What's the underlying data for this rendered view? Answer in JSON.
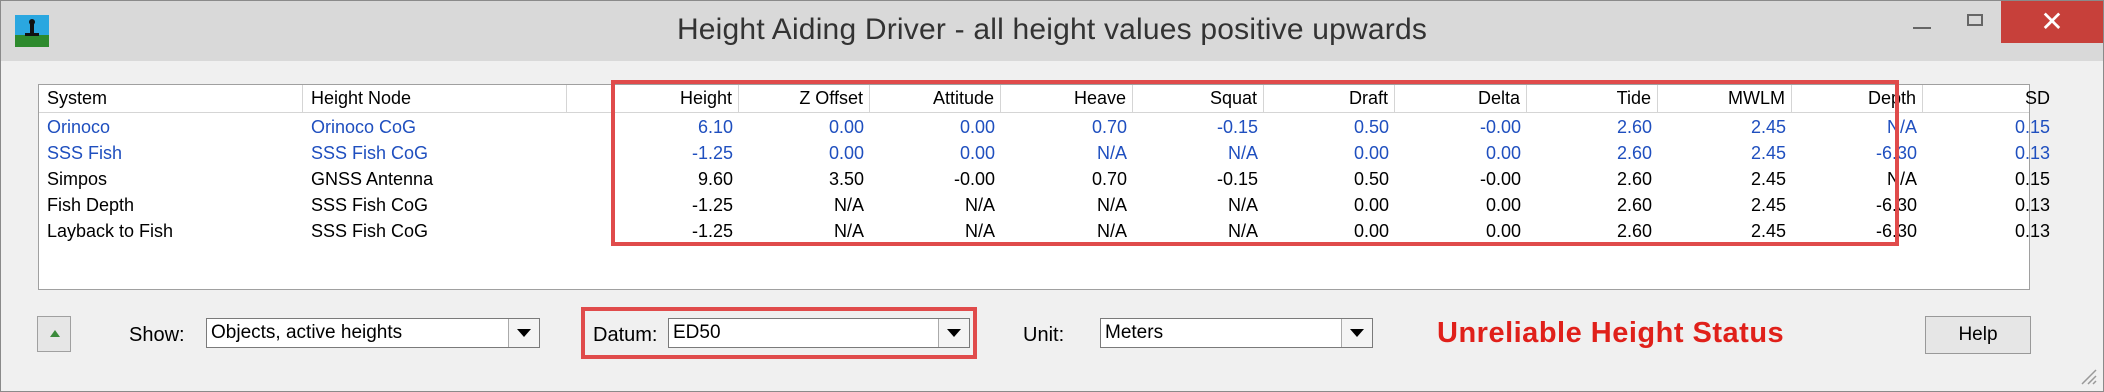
{
  "window": {
    "title": "Height Aiding Driver - all height values positive upwards"
  },
  "columns": [
    "System",
    "Height Node",
    "Height",
    "Z Offset",
    "Attitude",
    "Heave",
    "Squat",
    "Draft",
    "Delta",
    "Tide",
    "MWLM",
    "Depth",
    "SD"
  ],
  "rows": [
    {
      "style": "blue",
      "cells": [
        "Orinoco",
        "Orinoco CoG",
        "6.10",
        "0.00",
        "0.00",
        "0.70",
        "-0.15",
        "0.50",
        "-0.00",
        "2.60",
        "2.45",
        "N/A",
        "0.15"
      ]
    },
    {
      "style": "blue",
      "cells": [
        "SSS Fish",
        "SSS Fish CoG",
        "-1.25",
        "0.00",
        "0.00",
        "N/A",
        "N/A",
        "0.00",
        "0.00",
        "2.60",
        "2.45",
        "-6.30",
        "0.13"
      ]
    },
    {
      "style": "black",
      "cells": [
        "Simpos",
        "GNSS Antenna",
        "9.60",
        "3.50",
        "-0.00",
        "0.70",
        "-0.15",
        "0.50",
        "-0.00",
        "2.60",
        "2.45",
        "N/A",
        "0.15"
      ]
    },
    {
      "style": "black",
      "cells": [
        "Fish Depth",
        "SSS Fish CoG",
        "-1.25",
        "N/A",
        "N/A",
        "N/A",
        "N/A",
        "0.00",
        "0.00",
        "2.60",
        "2.45",
        "-6.30",
        "0.13"
      ]
    },
    {
      "style": "black",
      "cells": [
        "Layback to Fish",
        "SSS Fish CoG",
        "-1.25",
        "N/A",
        "N/A",
        "N/A",
        "N/A",
        "0.00",
        "0.00",
        "2.60",
        "2.45",
        "-6.30",
        "0.13"
      ]
    }
  ],
  "controls": {
    "show_label": "Show:",
    "show_value": "Objects, active heights",
    "datum_label": "Datum:",
    "datum_value": "ED50",
    "unit_label": "Unit:",
    "unit_value": "Meters",
    "status_text": "Unreliable Height Status",
    "help_label": "Help"
  },
  "colors": {
    "accent_red": "#e04b4b",
    "status_red": "#e0201a",
    "link_blue": "#1f4fbf"
  },
  "icons": {
    "close": "✕"
  }
}
